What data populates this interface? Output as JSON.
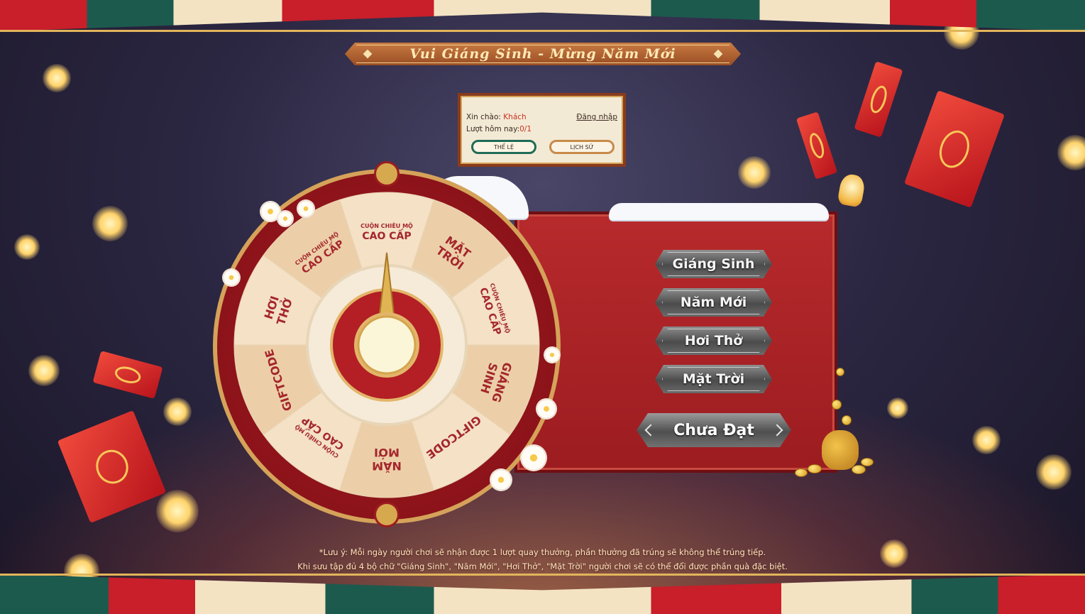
{
  "title": "Vui Giáng Sinh - Mừng Năm Mới",
  "info": {
    "greeting_label": "Xin chào:",
    "user_name": "Khách",
    "login_link": "Đăng nhập",
    "turns_label": "Lượt hôm nay:",
    "turns_value": "0/1",
    "rules_button": "THỂ LỆ",
    "history_button": "LỊCH SỬ"
  },
  "wheel": {
    "segments": [
      {
        "line1": "CUỘN CHIÊU MỘ",
        "line2": "CAO CẤP"
      },
      {
        "line1": "MẶT",
        "line2": "TRỜI"
      },
      {
        "line1": "CUỘN CHIÊU MỘ",
        "line2": "CAO CẤP"
      },
      {
        "line1": "GIÁNG",
        "line2": "SINH"
      },
      {
        "line1": "",
        "line2": "GIFTCODE"
      },
      {
        "line1": "NĂM",
        "line2": "MỚI"
      },
      {
        "line1": "CUỘN CHIÊU MỘ",
        "line2": "CAO CẤP"
      },
      {
        "line1": "",
        "line2": "GIFTCODE"
      },
      {
        "line1": "HƠI",
        "line2": "THỞ"
      },
      {
        "line1": "CUỘN CHIÊU MỘ",
        "line2": "CAO CẤP"
      }
    ]
  },
  "collection": {
    "words": [
      "Giáng Sinh",
      "Năm Mới",
      "Hơi Thở",
      "Mặt Trời"
    ],
    "reward_button": "Chưa Đạt"
  },
  "notes": {
    "line1": "*Lưu ý: Mỗi ngày người chơi sẽ nhận được 1 lượt quay thưởng, phần thưởng đã trúng sẽ không thể trúng tiếp.",
    "line2": "Khi sưu tập đủ 4 bộ chữ \"Giáng Sinh\", \"Năm Mới\", \"Hơi Thở\", \"Mặt Trời\" người chơi sẽ có thể đổi được phần quà đặc biệt."
  },
  "colors": {
    "accent_red": "#b72a2c",
    "gold": "#d5a25a",
    "green": "#1f6b57",
    "wheel_slice_light": "#f4e1c6",
    "wheel_slice_dark": "#eccfa9",
    "wheel_text": "#a4262b"
  }
}
